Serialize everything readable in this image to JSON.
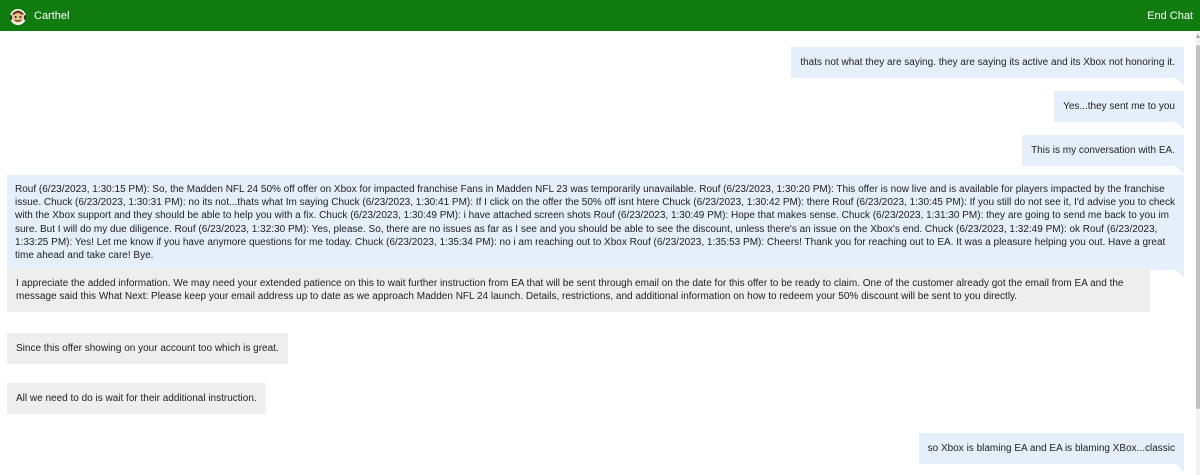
{
  "header": {
    "app_name": "Carthel",
    "end_chat_label": "End Chat",
    "logo_icon": "xbox-mascot-logo",
    "bar_color": "#107c10"
  },
  "messages": [
    {
      "side": "user",
      "text": "thats not what they are saying. they are saying its active and its Xbox not honoring it."
    },
    {
      "side": "user",
      "text": "Yes...they sent me to you"
    },
    {
      "side": "user",
      "text": "This is my conversation with EA."
    },
    {
      "side": "user",
      "text": "Rouf (6/23/2023, 1:30:15 PM): So, the Madden NFL 24 50% off offer on Xbox for impacted franchise Fans in Madden NFL 23 was temporarily unavailable. Rouf (6/23/2023, 1:30:20 PM): This offer is now live and is available for players impacted by the franchise issue. Chuck (6/23/2023, 1:30:31 PM): no its not...thats what Im saying Chuck (6/23/2023, 1:30:41 PM): If I click on the offer the 50% off isnt htere Chuck (6/23/2023, 1:30:42 PM): there Rouf (6/23/2023, 1:30:45 PM): If you still do not see it, I'd advise you to check with the Xbox support and they should be able to help you with a fix. Chuck (6/23/2023, 1:30:49 PM): i have attached screen shots Rouf (6/23/2023, 1:30:49 PM): Hope that makes sense. Chuck (6/23/2023, 1:31:30 PM): they are going to send me back to you im sure. But I will do my due diligence. Rouf (6/23/2023, 1:32:30 PM): Yes, please. So, there are no issues as far as I see and you should be able to see the discount, unless there's an issue on the Xbox's end. Chuck (6/23/2023, 1:32:49 PM): ok Rouf (6/23/2023, 1:33:25 PM): Yes! Let me know if you have anymore questions for me today. Chuck (6/23/2023, 1:35:34 PM): no i am reaching out to Xbox Rouf (6/23/2023, 1:35:53 PM): Cheers! Thank you for reaching out to EA. It was a pleasure helping you out. Have a great time ahead and take care! Bye."
    },
    {
      "side": "agent",
      "text": "I appreciate the added information. We may need your extended patience on this to wait further instruction from EA that will be sent through email on the date for this offer to be ready to claim. One of the customer already got the email from EA and the message said this What Next: Please keep your email address up to date as we approach Madden NFL 24 launch. Details, restrictions, and additional information on how to redeem your 50% discount will be sent to you directly."
    },
    {
      "side": "agent",
      "text": "Since this offer showing on your account too which is great."
    },
    {
      "side": "agent",
      "text": "All we need to do is wait for their additional instruction."
    },
    {
      "side": "user",
      "text": "so Xbox is blaming EA and EA is blaming XBox...classic"
    }
  ],
  "colors": {
    "user_bubble": "#e4effb",
    "agent_bubble": "#eeeeee"
  }
}
